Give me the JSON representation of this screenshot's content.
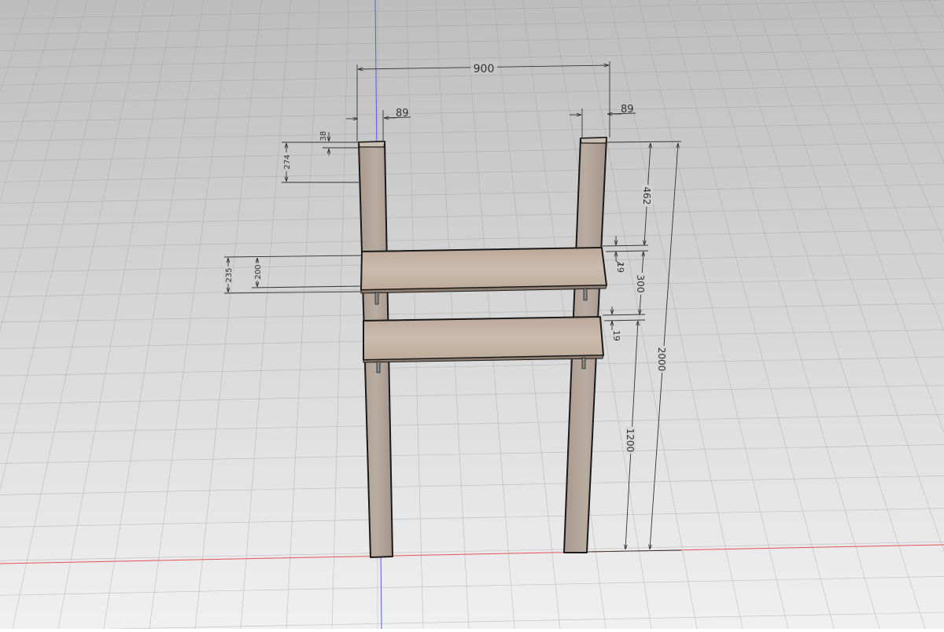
{
  "colors": {
    "bg_top": "#bdbdbd",
    "bg_bottom": "#f0f0f0",
    "grid": "#9a9a9a",
    "x_axis": "#e25555",
    "y_axis": "#5a5ae6",
    "wood_post": "#b5a89d",
    "wood_board": "#c4b3a3",
    "outline": "#1a1a1a",
    "dimension": "#333333"
  },
  "dimensions": {
    "overall_width": "900",
    "left_post_width": "89",
    "right_post_width": "89",
    "left_top_thickness": "38",
    "left_top_offset": "274",
    "left_board_offset": "200",
    "left_board_offset_2": "235",
    "right_top_to_board": "462",
    "upper_board_thickness": "19",
    "board_spacing": "300",
    "lower_board_thickness": "19",
    "lower_board_height": "1200",
    "overall_height": "2000"
  }
}
